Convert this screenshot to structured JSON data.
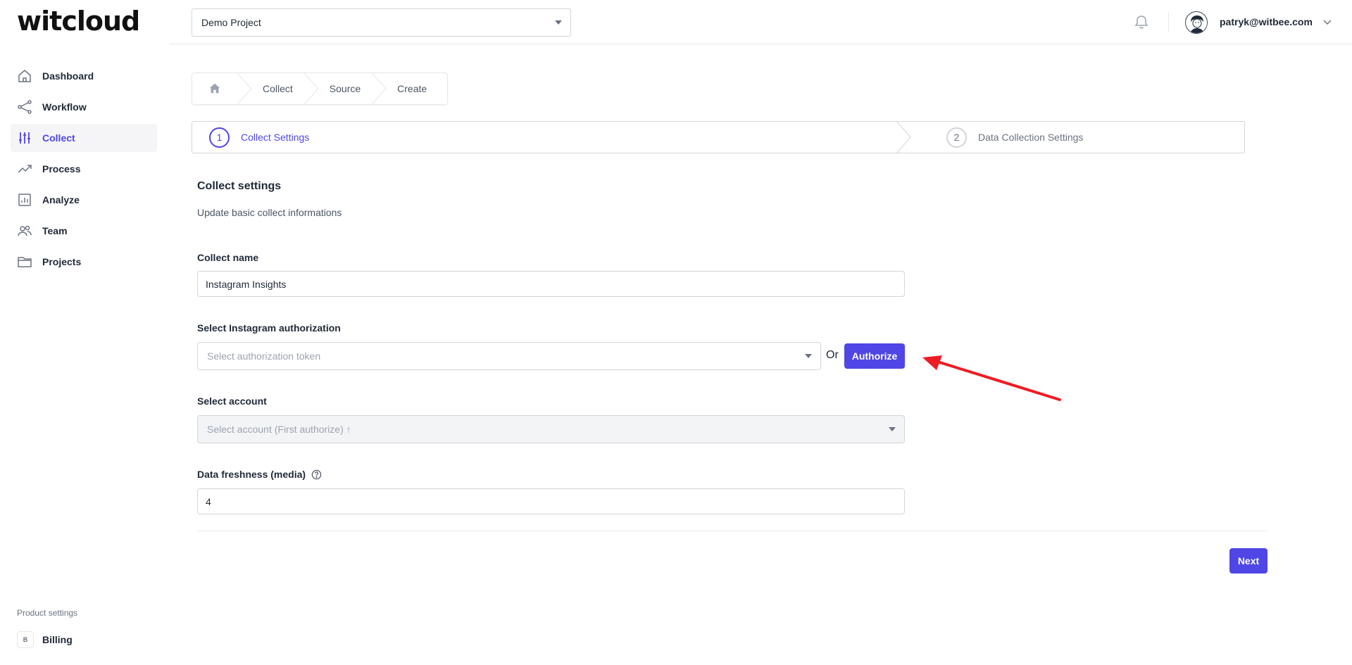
{
  "logo": {
    "text_before": "w",
    "text_it": "it",
    "text_after": "cloud"
  },
  "header": {
    "project": "Demo Project",
    "user_email": "patryk@witbee.com"
  },
  "sidebar": {
    "items": [
      {
        "label": "Dashboard",
        "icon": "home-icon"
      },
      {
        "label": "Workflow",
        "icon": "share-icon"
      },
      {
        "label": "Collect",
        "icon": "sliders-icon"
      },
      {
        "label": "Process",
        "icon": "trend-icon"
      },
      {
        "label": "Analyze",
        "icon": "bar-chart-icon"
      },
      {
        "label": "Team",
        "icon": "users-icon"
      },
      {
        "label": "Projects",
        "icon": "folder-icon"
      }
    ],
    "active": "Collect",
    "product_settings": "Product settings",
    "billing_badge": "B",
    "billing": "Billing"
  },
  "breadcrumb": [
    "Collect",
    "Source",
    "Create"
  ],
  "stepper": {
    "steps": [
      {
        "number": "1",
        "label": "Collect Settings",
        "state": "active"
      },
      {
        "number": "2",
        "label": "Data Collection Settings",
        "state": "inactive"
      }
    ]
  },
  "form": {
    "title": "Collect settings",
    "subtitle": "Update basic collect informations",
    "collect_name_label": "Collect name",
    "collect_name_value": "Instagram Insights",
    "auth_label": "Select Instagram authorization",
    "auth_placeholder": "Select authorization token",
    "or_text": "Or",
    "authorize_button": "Authorize",
    "account_label": "Select account",
    "account_placeholder": "Select account (First authorize) ↑",
    "freshness_label": "Data freshness (media)",
    "freshness_value": "4",
    "next_button": "Next"
  },
  "colors": {
    "accent": "#4f46e5",
    "annotation_arrow": "#ee1c24"
  }
}
